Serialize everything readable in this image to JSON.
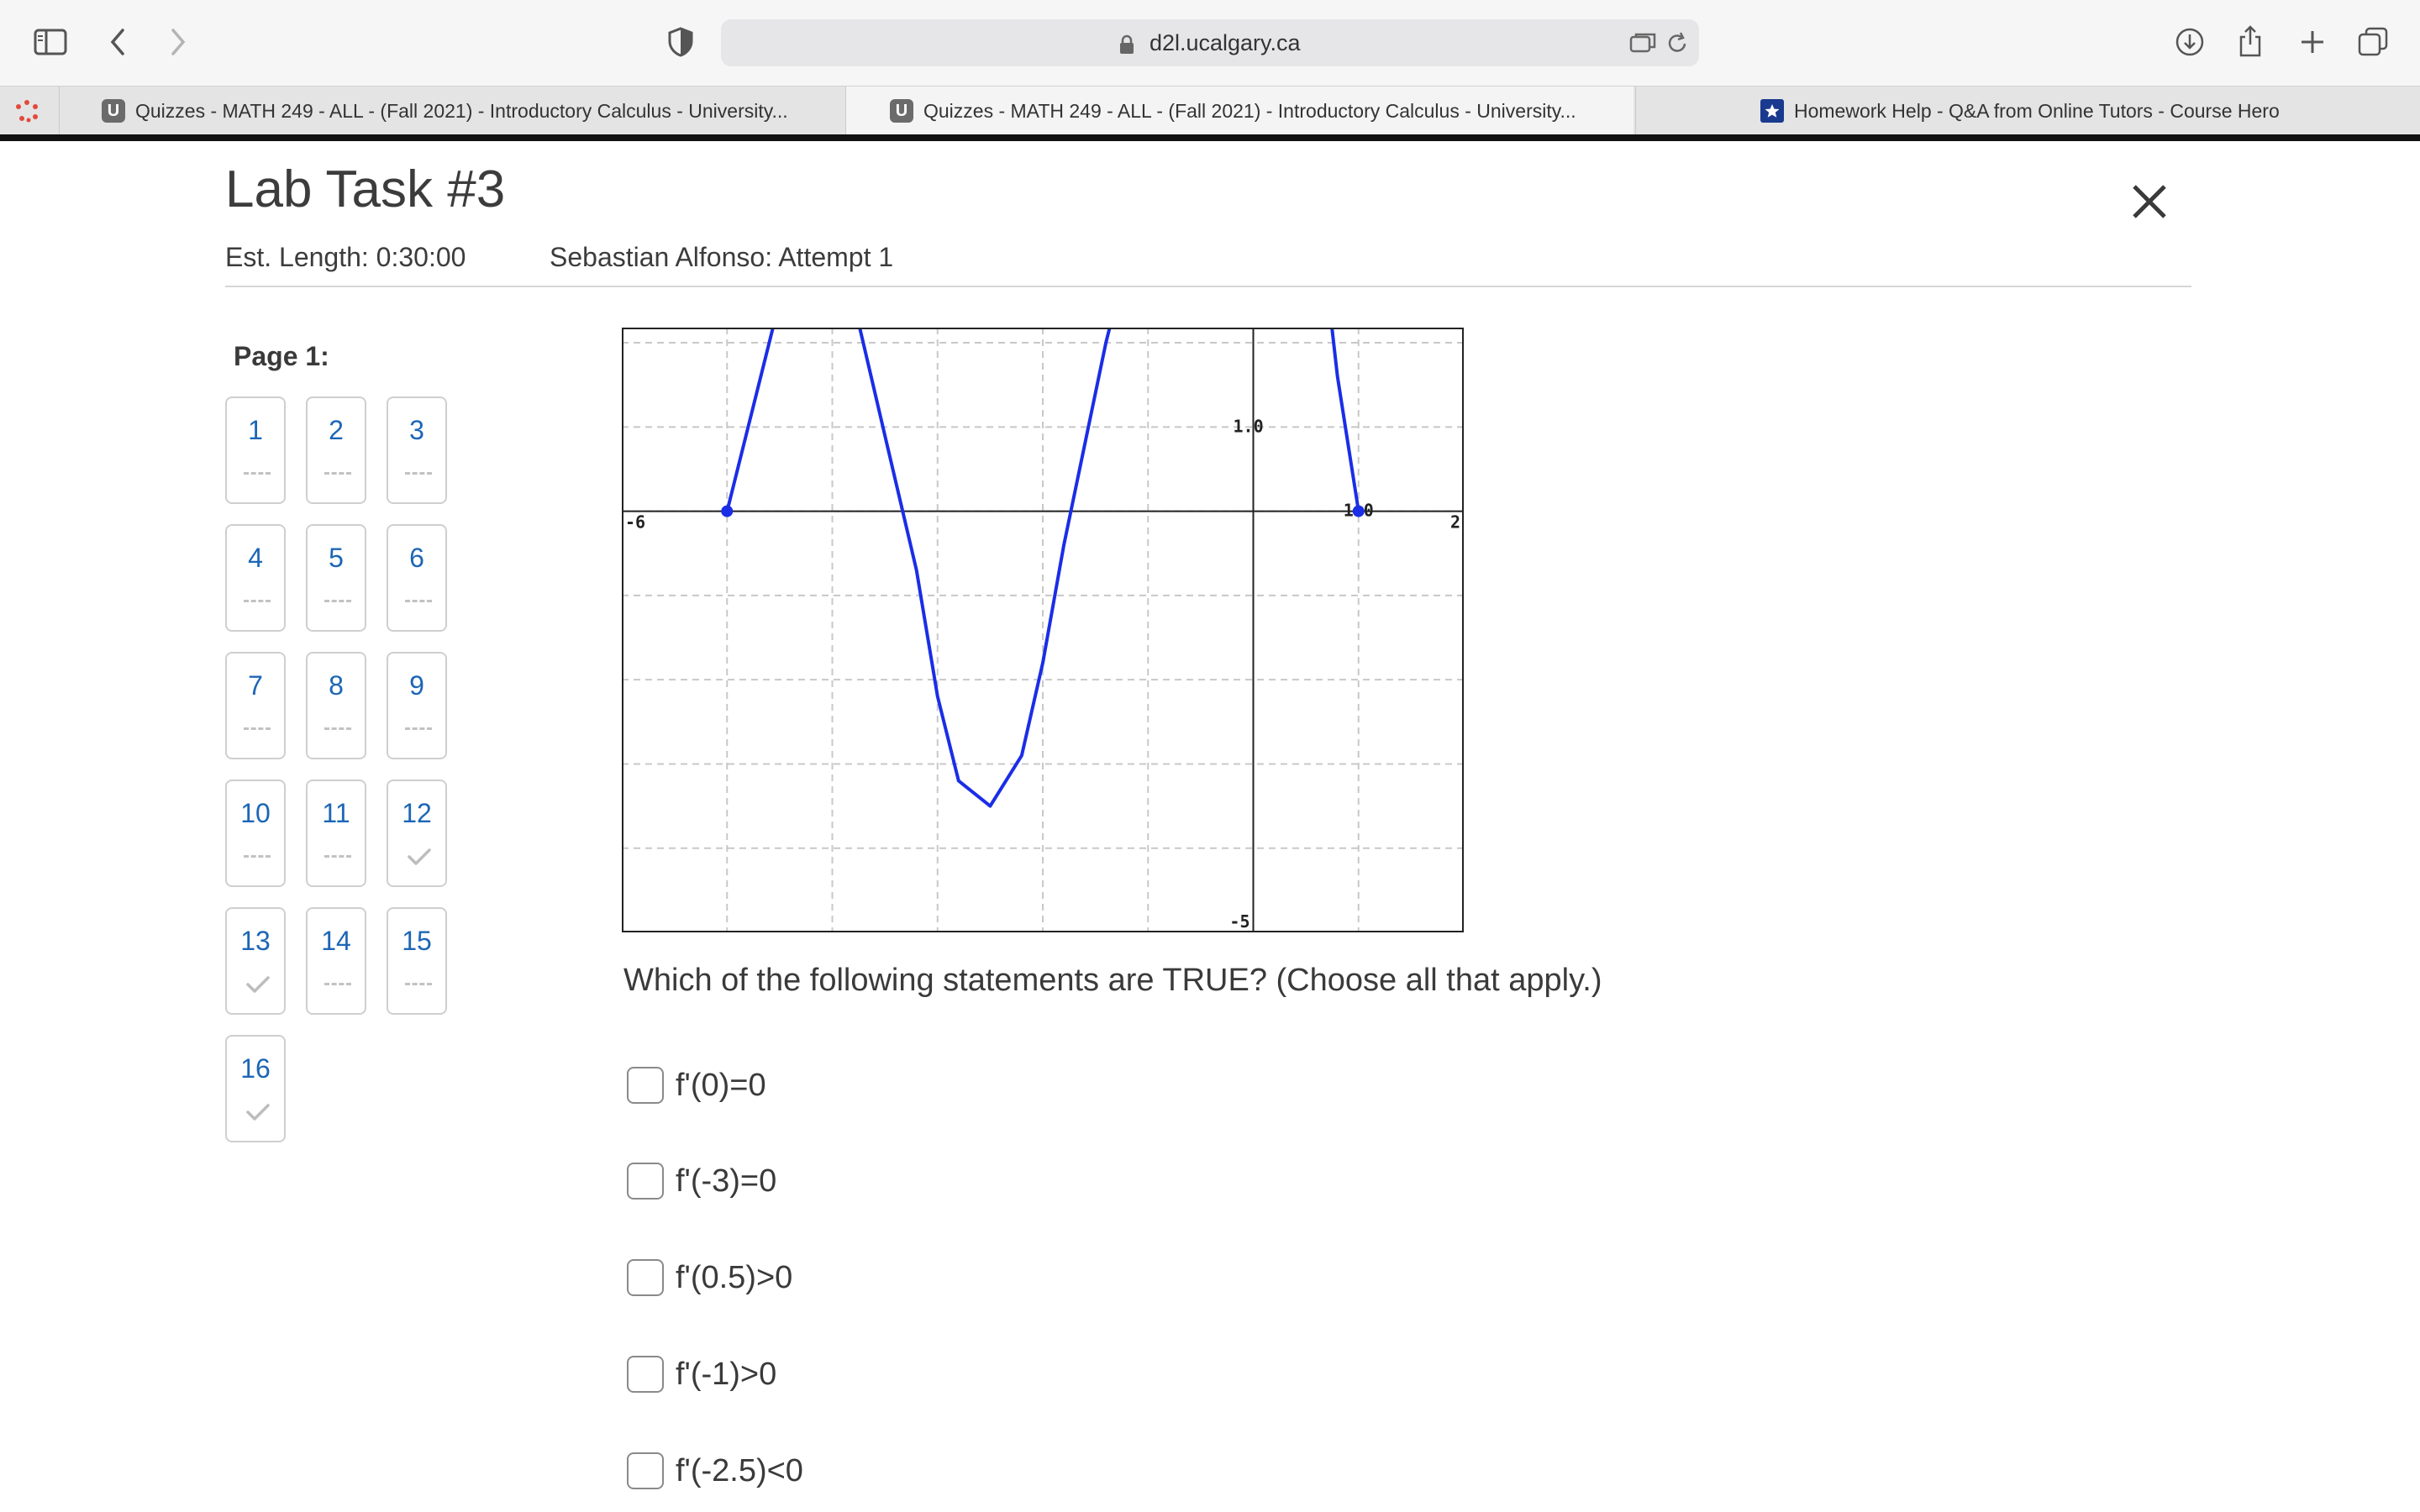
{
  "browser": {
    "address": "d2l.ucalgary.ca",
    "tabs": [
      {
        "title": "Quizzes - MATH 249 - ALL - (Fall 2021) - Introductory Calculus - University...",
        "favicon": "U"
      },
      {
        "title": "Quizzes - MATH 249 - ALL - (Fall 2021) - Introductory Calculus - University...",
        "favicon": "U"
      },
      {
        "title": "Homework Help - Q&A from Online Tutors - Course Hero",
        "favicon": "star-icon"
      }
    ]
  },
  "quiz": {
    "title": "Lab Task #3",
    "est_length": "Est. Length: 0:30:00",
    "attempt": "Sebastian Alfonso: Attempt 1",
    "page_label": "Page 1:",
    "questions": [
      {
        "number": "1",
        "answered": false
      },
      {
        "number": "2",
        "answered": false
      },
      {
        "number": "3",
        "answered": false
      },
      {
        "number": "4",
        "answered": false
      },
      {
        "number": "5",
        "answered": false
      },
      {
        "number": "6",
        "answered": false
      },
      {
        "number": "7",
        "answered": false
      },
      {
        "number": "8",
        "answered": false
      },
      {
        "number": "9",
        "answered": false
      },
      {
        "number": "10",
        "answered": false
      },
      {
        "number": "11",
        "answered": false
      },
      {
        "number": "12",
        "answered": true
      },
      {
        "number": "13",
        "answered": true
      },
      {
        "number": "14",
        "answered": false
      },
      {
        "number": "15",
        "answered": false
      },
      {
        "number": "16",
        "answered": true
      }
    ],
    "question_text": "Which of the following statements are TRUE? (Choose all that apply.)",
    "choices": [
      "f'(0)=0",
      "f'(-3)=0",
      "f'(0.5)>0",
      "f'(-1)>0",
      "f'(-2.5)<0"
    ]
  },
  "chart_data": {
    "type": "line",
    "xlim": [
      -6,
      2
    ],
    "ylim": [
      -5,
      2
    ],
    "tick_labels": {
      "x_min": "-6",
      "x_max": "2",
      "y_unit": "1.0",
      "y_min": "-5",
      "x_unit": "1.0"
    },
    "grid": true,
    "series": [
      {
        "x": [
          -5,
          -4.6,
          -4.2,
          -3.8,
          -3.5,
          -3.2,
          -3,
          -2.8,
          -2.5,
          -2.2,
          -2,
          -1.8,
          -1.4,
          -1,
          0.6,
          0.8,
          1
        ],
        "y": [
          0,
          2.0,
          4.0,
          2.5,
          0.9,
          -0.7,
          -2.2,
          -3.2,
          -3.5,
          -2.9,
          -1.8,
          -0.4,
          2.0,
          4.0,
          3.8,
          1.6,
          0
        ]
      }
    ],
    "endpoints": [
      {
        "x": -5,
        "y": 0
      },
      {
        "x": 1,
        "y": 0
      }
    ],
    "color": "#1a2ee6"
  }
}
